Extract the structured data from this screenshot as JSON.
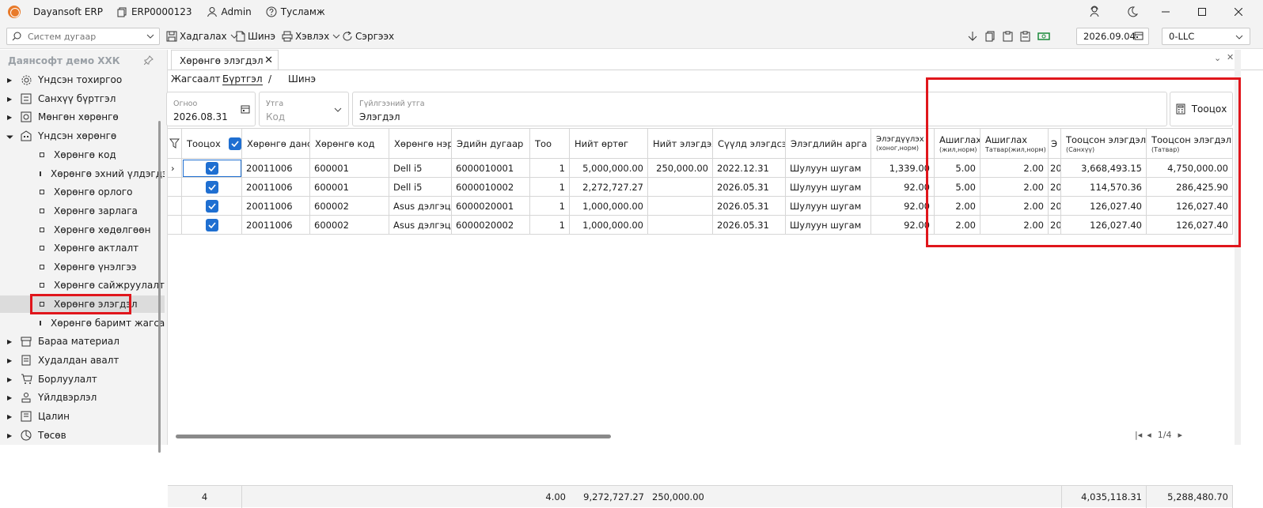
{
  "app": {
    "name": "Dayansoft ERP",
    "code": "ERP0000123",
    "user": "Admin",
    "help": "Тусламж"
  },
  "toolbar": {
    "search_placeholder": "Систем дугаар",
    "save": "Хадгалах",
    "new": "Шинэ",
    "print": "Хэвлэх",
    "refresh": "Сэргээх",
    "date": "2026.09.04",
    "org": "0-LLC"
  },
  "sidebar": {
    "title": "Даянсофт демо ХХК",
    "items": [
      {
        "label": "Үндсэн тохиргоо",
        "icon": "gear-icon"
      },
      {
        "label": "Санхүү бүртгэл",
        "icon": "ledger-icon"
      },
      {
        "label": "Мөнгөн хөрөнгө",
        "icon": "cash-icon"
      },
      {
        "label": "Үндсэн хөрөнгө",
        "icon": "building-icon"
      },
      {
        "label": "Хөрөнгө код"
      },
      {
        "label": "Хөрөнгө эхний үлдэгдэл"
      },
      {
        "label": "Хөрөнгө орлого"
      },
      {
        "label": "Хөрөнгө зарлага"
      },
      {
        "label": "Хөрөнгө хөдөлгөөн"
      },
      {
        "label": "Хөрөнгө актлалт"
      },
      {
        "label": "Хөрөнгө үнэлгээ"
      },
      {
        "label": "Хөрөнгө сайжруулалт"
      },
      {
        "label": "Хөрөнгө элэгдэл"
      },
      {
        "label": "Хөрөнгө баримт жагсаалт"
      },
      {
        "label": "Бараа материал",
        "icon": "box-icon"
      },
      {
        "label": "Худалдан авалт",
        "icon": "receipt-icon"
      },
      {
        "label": "Борлуулалт",
        "icon": "cart-icon"
      },
      {
        "label": "Үйлдвэрлэл",
        "icon": "factory-icon"
      },
      {
        "label": "Цалин",
        "icon": "payroll-icon"
      },
      {
        "label": "Төсөв",
        "icon": "pie-icon"
      }
    ]
  },
  "main": {
    "tab": "Хөрөнгө элэгдэл",
    "breadcrumb": {
      "list": "Жагсаалт",
      "register": "Бүртгэл",
      "sep": "/",
      "new": "Шинэ"
    },
    "form": {
      "date_label": "Огноо",
      "date_value": "2026.08.31",
      "key_label": "Утга",
      "key_placeholder": "Код",
      "desc_label": "Гүйлгээний утга",
      "desc_value": "Элэгдэл",
      "calc_button": "Тооцох"
    },
    "columns": [
      {
        "title": "Тооцох"
      },
      {
        "title": "Хөрөнгө данс"
      },
      {
        "title": "Хөрөнгө код"
      },
      {
        "title": "Хөрөнгө нэр"
      },
      {
        "title": "Эдийн дугаар"
      },
      {
        "title": "Тоо"
      },
      {
        "title": "Нийт өртөг"
      },
      {
        "title": "Нийт элэгдэл"
      },
      {
        "title": "Сүүлд элэгдсэн"
      },
      {
        "title": "Элэгдлийн арга"
      },
      {
        "title": "Элэгдүүлэх",
        "sub": "(хоног,норм)"
      },
      {
        "title": "Ашиглах",
        "sub": "(жил,норм)"
      },
      {
        "title": "Ашиглах",
        "sub": "Татвар(жил,норм)"
      },
      {
        "title": "Э"
      },
      {
        "title": "Тооцсон элэгдэл",
        "sub": "(Санхүү)"
      },
      {
        "title": "Тооцсон элэгдэл",
        "sub": "(Татвар)"
      }
    ],
    "rows": [
      [
        "20011006",
        "600001",
        "Dell i5",
        "6000010001",
        "1",
        "5,000,000.00",
        "250,000.00",
        "2022.12.31",
        "Шулуун шугам",
        "1,339.00",
        "5.00",
        "2.00",
        "20",
        "3,668,493.15",
        "4,750,000.00"
      ],
      [
        "20011006",
        "600001",
        "Dell i5",
        "6000010002",
        "1",
        "2,272,727.27",
        "",
        "2026.05.31",
        "Шулуун шугам",
        "92.00",
        "5.00",
        "2.00",
        "20",
        "114,570.36",
        "286,425.90"
      ],
      [
        "20011006",
        "600002",
        "Asus дэлгэц",
        "6000020001",
        "1",
        "1,000,000.00",
        "",
        "2026.05.31",
        "Шулуун шугам",
        "92.00",
        "2.00",
        "2.00",
        "20",
        "126,027.40",
        "126,027.40"
      ],
      [
        "20011006",
        "600002",
        "Asus дэлгэц",
        "6000020002",
        "1",
        "1,000,000.00",
        "",
        "2026.05.31",
        "Шулуун шугам",
        "92.00",
        "2.00",
        "2.00",
        "20",
        "126,027.40",
        "126,027.40"
      ]
    ],
    "footer": {
      "count": "4",
      "qty": "4.00",
      "cost": "9,272,727.27",
      "depr": "250,000.00",
      "calc_fin": "4,035,118.31",
      "calc_tax": "5,288,480.70"
    },
    "pager": "1/4"
  }
}
